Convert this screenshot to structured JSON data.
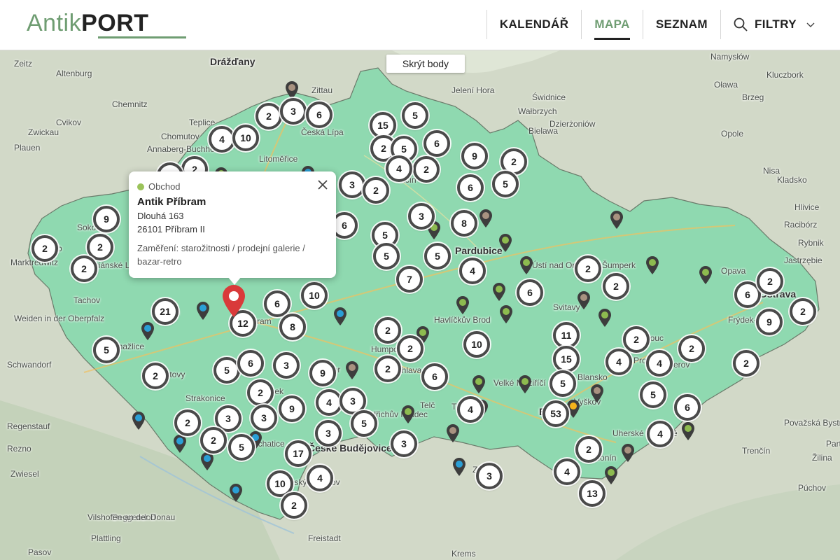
{
  "header": {
    "logo_antik": "Antik",
    "logo_port": "PORT",
    "nav": [
      {
        "label": "KALENDÁŘ",
        "active": false
      },
      {
        "label": "MAPA",
        "active": true
      },
      {
        "label": "SEZNAM",
        "active": false
      }
    ],
    "filter_label": "FILTRY",
    "icons": {
      "search": "search-icon",
      "chevron": "chevron-down-icon"
    }
  },
  "map": {
    "hide_points_label": "Skrýt body",
    "colors": {
      "region": "#8fd9b0",
      "background": "#cfd8c4",
      "cluster_border": "#4a4a4a",
      "pin_red": "#d93a3a",
      "pin_blue": "#2a9fd6",
      "pin_green": "#8dbb4f",
      "pin_brown": "#a89280",
      "pin_orange": "#f3b21b"
    },
    "places": [
      {
        "text": "Drážďany",
        "big": true
      },
      {
        "text": "Zittau"
      },
      {
        "text": "Jelení Hora"
      },
      {
        "text": "Wałbrzych"
      },
      {
        "text": "Świdnice"
      },
      {
        "text": "Namysłów"
      },
      {
        "text": "Oława"
      },
      {
        "text": "Kluczbork"
      },
      {
        "text": "Brzeg"
      },
      {
        "text": "Opole"
      },
      {
        "text": "Nisa"
      },
      {
        "text": "Kladsko"
      },
      {
        "text": "Bielawa"
      },
      {
        "text": "Dzierżoniów"
      },
      {
        "text": "Chemnitz"
      },
      {
        "text": "Zeitz"
      },
      {
        "text": "Altenburg"
      },
      {
        "text": "Zwickau"
      },
      {
        "text": "Plauen"
      },
      {
        "text": "Annaberg-Buchholz"
      },
      {
        "text": "Teplice"
      },
      {
        "text": "Česká Lípa"
      },
      {
        "text": "Litoměřice"
      },
      {
        "text": "Jičín"
      },
      {
        "text": "Pardubice",
        "big": true
      },
      {
        "text": "Ústí nad Orlicí"
      },
      {
        "text": "Šumperk"
      },
      {
        "text": "Opava"
      },
      {
        "text": "Ostrava",
        "big": true
      },
      {
        "text": "Hlivice"
      },
      {
        "text": "Racibórz"
      },
      {
        "text": "Rybnik"
      },
      {
        "text": "Jastrzębie"
      },
      {
        "text": "Frýdek-Místek"
      },
      {
        "text": "Olomouc"
      },
      {
        "text": "Prostějov"
      },
      {
        "text": "Přerov"
      },
      {
        "text": "Svitavy"
      },
      {
        "text": "Havlíčkův Brod"
      },
      {
        "text": "Humpolec"
      },
      {
        "text": "Jihlava"
      },
      {
        "text": "Velké Meziříčí"
      },
      {
        "text": "Třebíč"
      },
      {
        "text": "Telč"
      },
      {
        "text": "Brno",
        "big": true
      },
      {
        "text": "Vyškov"
      },
      {
        "text": "Blansko"
      },
      {
        "text": "Znojmo"
      },
      {
        "text": "Hodonín"
      },
      {
        "text": "Uherské Hradiště"
      },
      {
        "text": "Trenčín"
      },
      {
        "text": "Plzeň",
        "big": true
      },
      {
        "text": "Tachov"
      },
      {
        "text": "Domažlice"
      },
      {
        "text": "Klatovy"
      },
      {
        "text": "Strakonice"
      },
      {
        "text": "Písek"
      },
      {
        "text": "Tábor"
      },
      {
        "text": "Jindřichův Hradec"
      },
      {
        "text": "České Budějovice",
        "big": true
      },
      {
        "text": "Český Krumlov"
      },
      {
        "text": "Prachatice"
      },
      {
        "text": "Příbram"
      },
      {
        "text": "Sokolov"
      },
      {
        "text": "Cheb"
      },
      {
        "text": "Mariánské Lázně"
      },
      {
        "text": "Marktredwitz"
      },
      {
        "text": "Weiden in der Oberpfalz"
      },
      {
        "text": "Schwandorf"
      },
      {
        "text": "Regenstauf"
      },
      {
        "text": "Rezno"
      },
      {
        "text": "Zwiesel"
      },
      {
        "text": "Deggendorf"
      },
      {
        "text": "Plattling"
      },
      {
        "text": "Vilshofen an der Donau"
      },
      {
        "text": "Pasov"
      },
      {
        "text": "Freistadt"
      },
      {
        "text": "Krems"
      },
      {
        "text": "Púchov"
      },
      {
        "text": "Považská Bystrica"
      },
      {
        "text": "Žilina"
      },
      {
        "text": "Partizánske"
      },
      {
        "text": "Chomutov"
      },
      {
        "text": "Cvikov"
      }
    ],
    "clusters": [
      "2",
      "3",
      "6",
      "5",
      "15",
      "4",
      "10",
      "2",
      "5",
      "6",
      "2",
      "2",
      "9",
      "2",
      "4",
      "2",
      "3",
      "2",
      "6",
      "5",
      "9",
      "2",
      "2",
      "2",
      "3",
      "8",
      "6",
      "5",
      "5",
      "5",
      "7",
      "4",
      "10",
      "6",
      "21",
      "12",
      "6",
      "2",
      "8",
      "2",
      "6",
      "2",
      "2",
      "5",
      "9",
      "11",
      "2",
      "2",
      "2",
      "10",
      "15",
      "2",
      "4",
      "2",
      "2",
      "3",
      "9",
      "6",
      "4",
      "2",
      "5",
      "6",
      "9",
      "4",
      "3",
      "2",
      "3",
      "5",
      "53",
      "5",
      "4",
      "3",
      "6",
      "2",
      "17",
      "5",
      "3",
      "4",
      "3",
      "4",
      "10",
      "4",
      "3",
      "2",
      "13",
      "2",
      "5",
      "2"
    ],
    "pins_count": 30
  },
  "popup": {
    "category": "Obchod",
    "name": "Antik Příbram",
    "street": "Dlouhá 163",
    "city": "26101 Příbram II",
    "focus": "Zaměření: starožitnosti / prodejní galerie / bazar-retro",
    "close_icon": "close-icon"
  }
}
